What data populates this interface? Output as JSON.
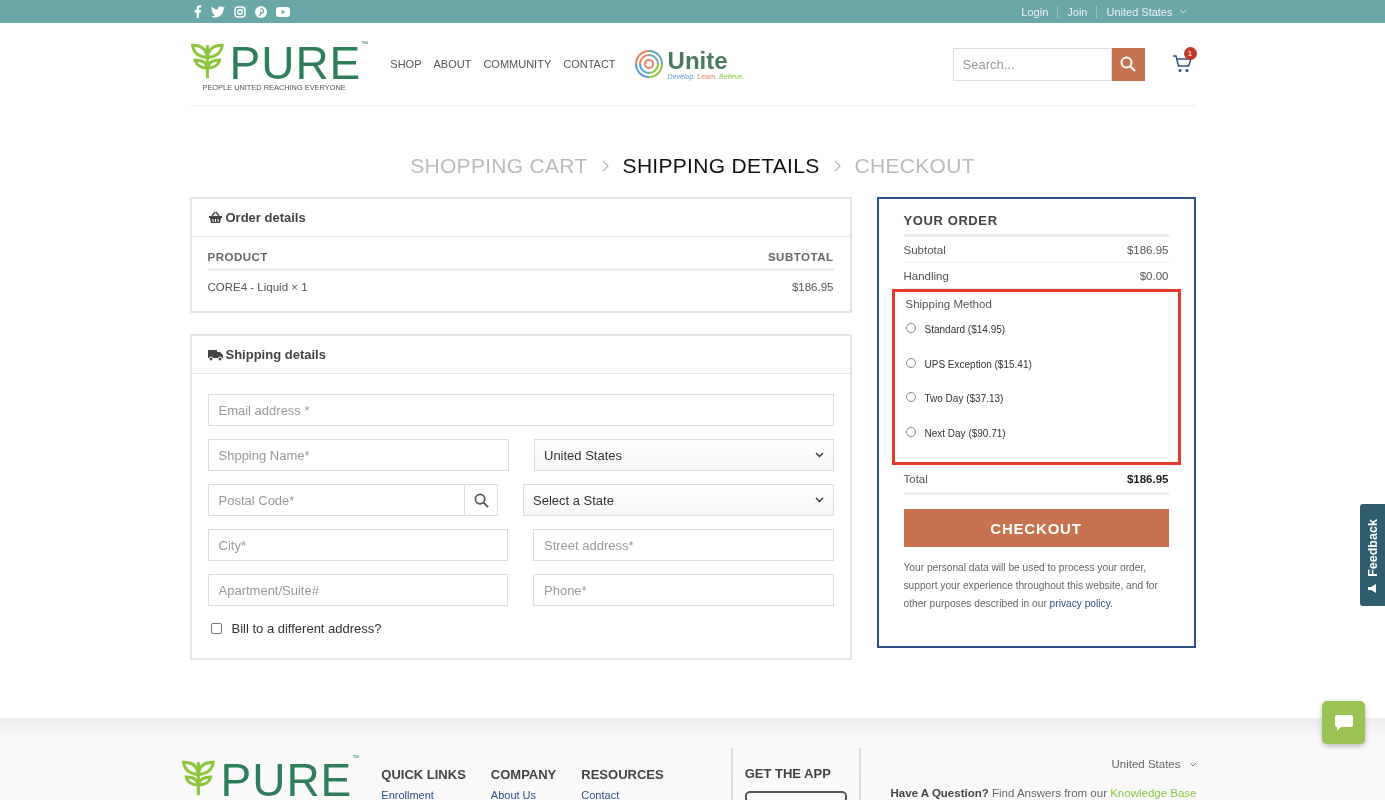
{
  "top_bar": {
    "links": [
      "Login",
      "Join"
    ],
    "region": "United States"
  },
  "header": {
    "logo": {
      "name": "PURE",
      "trademark": "™",
      "tagline": "PEOPLE UNITED REACHING EVERYONE"
    },
    "nav": [
      "SHOP",
      "ABOUT",
      "COMMUNITY",
      "CONTACT"
    ],
    "partner_logo": {
      "name": "Unite",
      "tagline": [
        "Develop.",
        "Learn.",
        "Believe."
      ]
    },
    "search": {
      "placeholder": "Search..."
    },
    "cart": {
      "count": "1"
    }
  },
  "steps": [
    {
      "label": "SHOPPING CART",
      "selected": false
    },
    {
      "label": "SHIPPING DETAILS",
      "selected": true
    },
    {
      "label": "CHECKOUT",
      "selected": false
    }
  ],
  "order_details": {
    "title": "Order details",
    "columns": [
      "PRODUCT",
      "SUBTOTAL"
    ],
    "rows": [
      [
        "CORE4 - Liquid × 1",
        "$186.95"
      ]
    ]
  },
  "shipping_details": {
    "title": "Shipping details",
    "rows": [
      [
        {
          "kind": "text",
          "placeholder": "Email address *"
        }
      ],
      [
        {
          "kind": "text",
          "placeholder": "Shpping Name*"
        },
        {
          "kind": "select",
          "value": "United States"
        }
      ],
      [
        {
          "kind": "postal",
          "placeholder": "Postal Code*"
        },
        {
          "kind": "select",
          "value": "Select a State"
        }
      ],
      [
        {
          "kind": "text",
          "placeholder": "City*"
        },
        {
          "kind": "text",
          "placeholder": "Street address*"
        }
      ],
      [
        {
          "kind": "text",
          "placeholder": "Apartment/Suite#"
        },
        {
          "kind": "text",
          "placeholder": "Phone*"
        }
      ]
    ],
    "bill_different": {
      "label": "Bill to a different address?",
      "checked": false
    }
  },
  "your_order": {
    "title": "YOUR ORDER",
    "lines": [
      {
        "label": "Subtotal",
        "value": "$186.95"
      },
      {
        "label": "Handling",
        "value": "$0.00"
      }
    ],
    "shipping_method": {
      "label": "Shipping Method",
      "highlighted": true,
      "options": [
        {
          "label": "Standard ($14.95)",
          "selected": false
        },
        {
          "label": "UPS Exception ($15.41)",
          "selected": false
        },
        {
          "label": "Two Day ($37.13)",
          "selected": false
        },
        {
          "label": "Next Day ($90.71)",
          "selected": false
        }
      ]
    },
    "total": {
      "label": "Total",
      "value": "$186.95"
    },
    "checkout_button": "CHECKOUT",
    "notice": "Your personal data will be used to process your order, support your experience throughout this website, and for other purposes described in our ",
    "privacy_link": "privacy policy",
    "notice_end": "."
  },
  "footer": {
    "logo": {
      "name": "PURE",
      "trademark": "™"
    },
    "columns": [
      {
        "title": "QUICK LINKS",
        "links": [
          "Enrollment"
        ]
      },
      {
        "title": "COMPANY",
        "links": [
          "About Us"
        ]
      },
      {
        "title": "RESOURCES",
        "links": [
          "Contact"
        ]
      }
    ],
    "app": {
      "title": "GET THE APP"
    },
    "region": "United States",
    "question": "**Have A Question?** Find Answers from our ",
    "question_link": "Knowledge Base"
  },
  "feedback": {
    "label": "Feedback"
  }
}
